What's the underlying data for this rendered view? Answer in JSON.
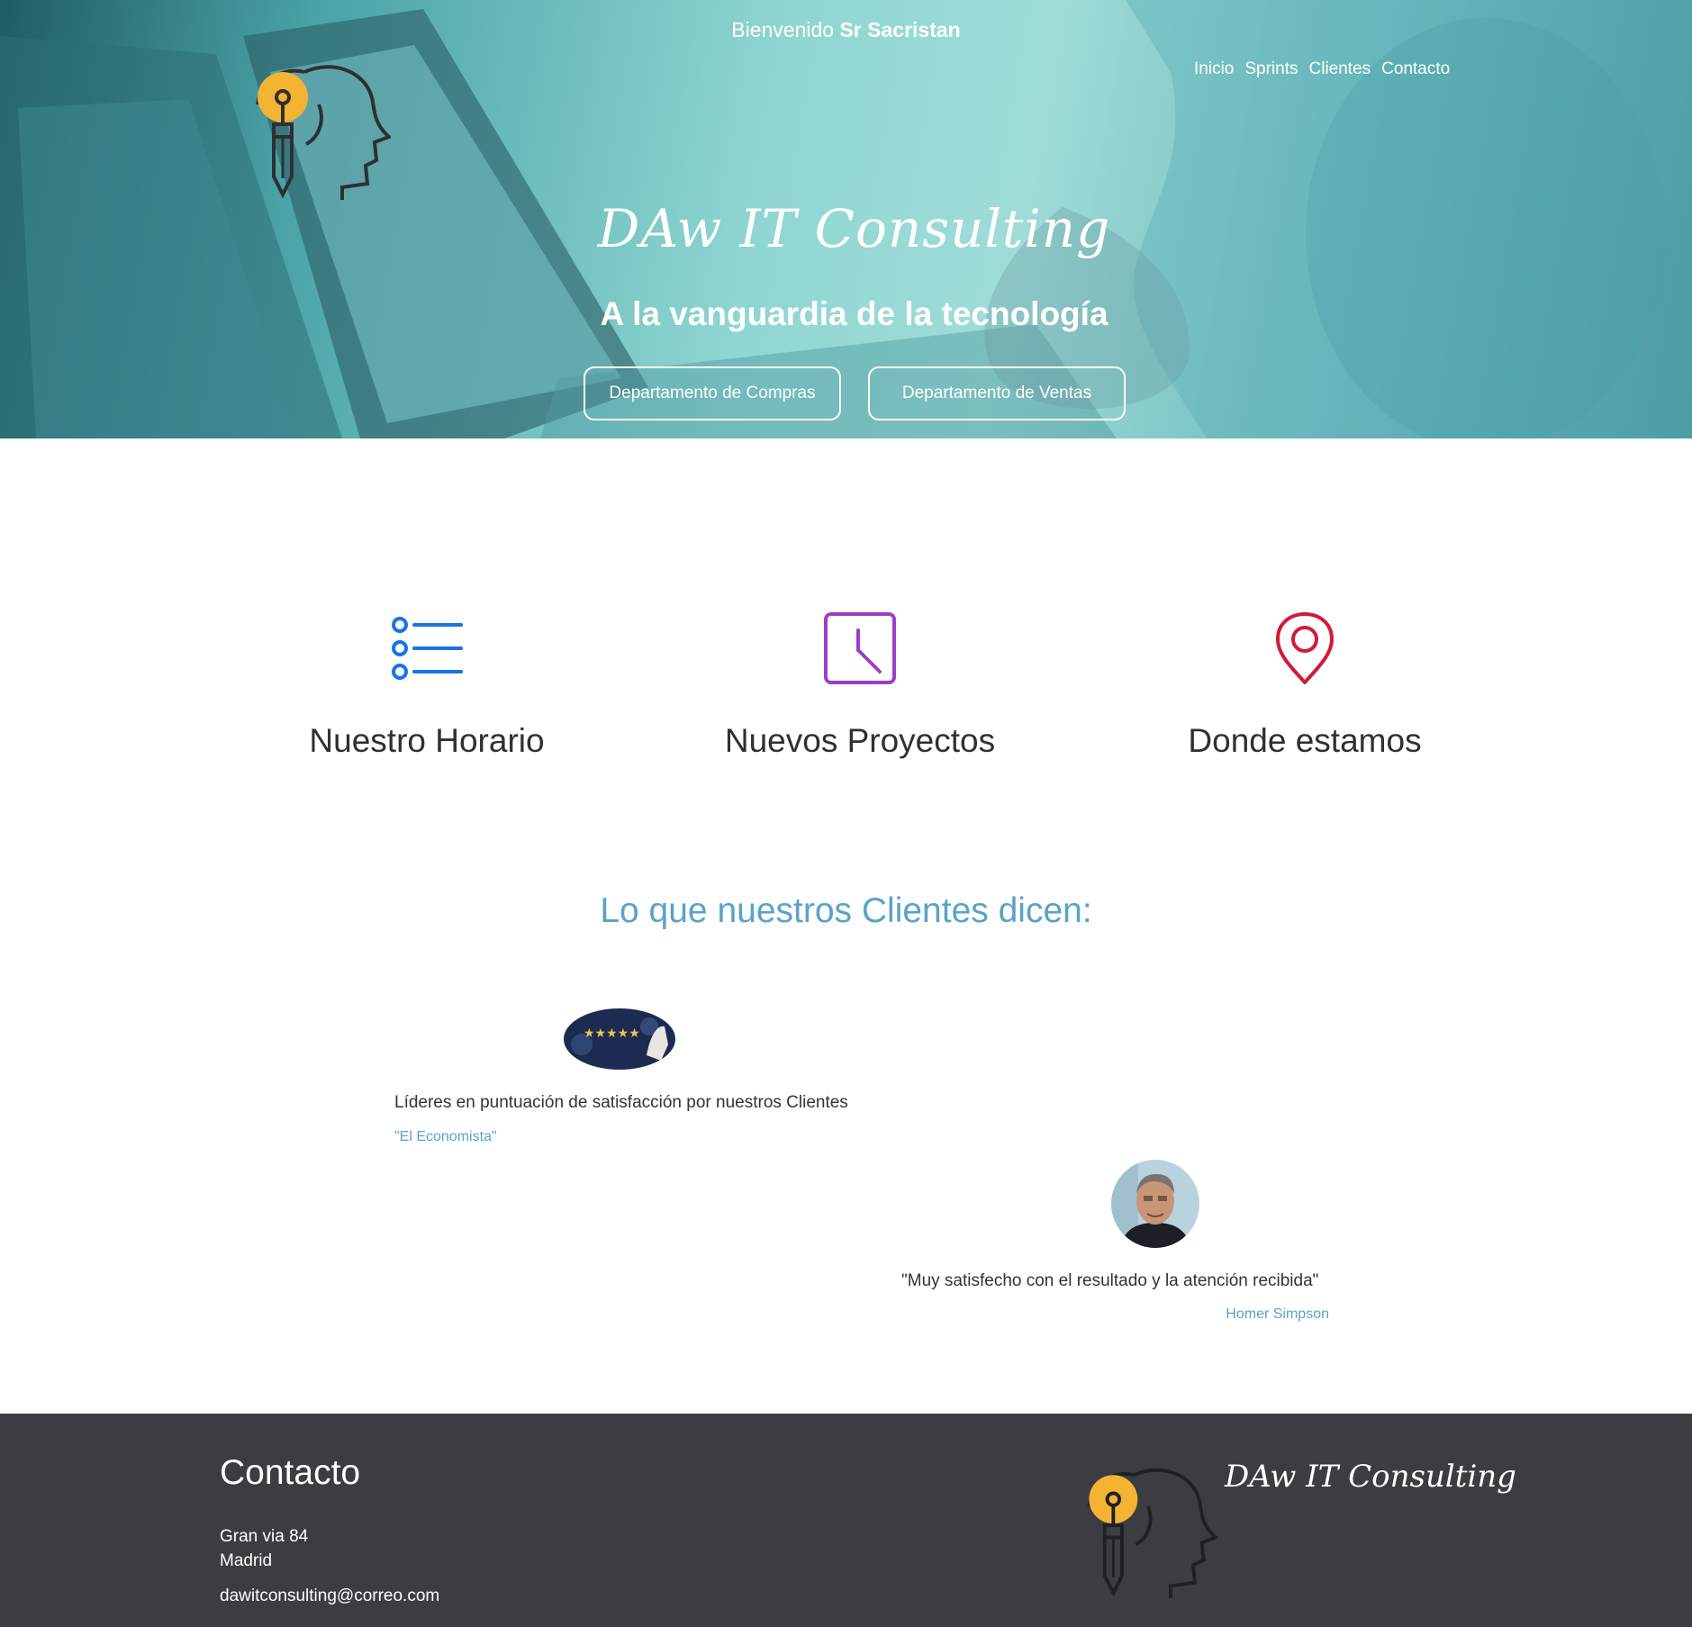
{
  "header": {
    "welcome_prefix": "Bienvenido",
    "welcome_user": "Sr Sacristan",
    "nav": [
      "Inicio",
      "Sprints",
      "Clientes",
      "Contacto"
    ]
  },
  "hero": {
    "brand": "DAw IT Consulting",
    "tagline": "A la vanguardia de la tecnología",
    "buttons": [
      "Departamento de Compras",
      "Departamento de Ventas"
    ]
  },
  "features": [
    {
      "title": "Nuestro Horario",
      "icon": "list-icon",
      "color": "#1a73e8"
    },
    {
      "title": "Nuevos Proyectos",
      "icon": "clock-icon",
      "color": "#9b3fc8"
    },
    {
      "title": "Donde estamos",
      "icon": "map-pin-icon",
      "color": "#d11a3a"
    }
  ],
  "testimonials": {
    "title": "Lo que nuestros Clientes dicen:",
    "items": [
      {
        "text": "Líderes en puntuación de satisfacción por nuestros Clientes",
        "source": "\"El Economista\"",
        "image": "rating-stars-image"
      },
      {
        "text": "\"Muy satisfecho con el resultado y la atención recibida\"",
        "source": "Homer Simpson",
        "image": "customer-avatar"
      }
    ]
  },
  "footer": {
    "title": "Contacto",
    "address_line1": "Gran via 84",
    "address_line2": "Madrid",
    "email": "dawitconsulting@correo.com",
    "brand": "DAw IT Consulting"
  },
  "colors": {
    "accent": "#5ba2c8",
    "footer_bg": "#3b3d42",
    "bulb": "#f5b333"
  }
}
